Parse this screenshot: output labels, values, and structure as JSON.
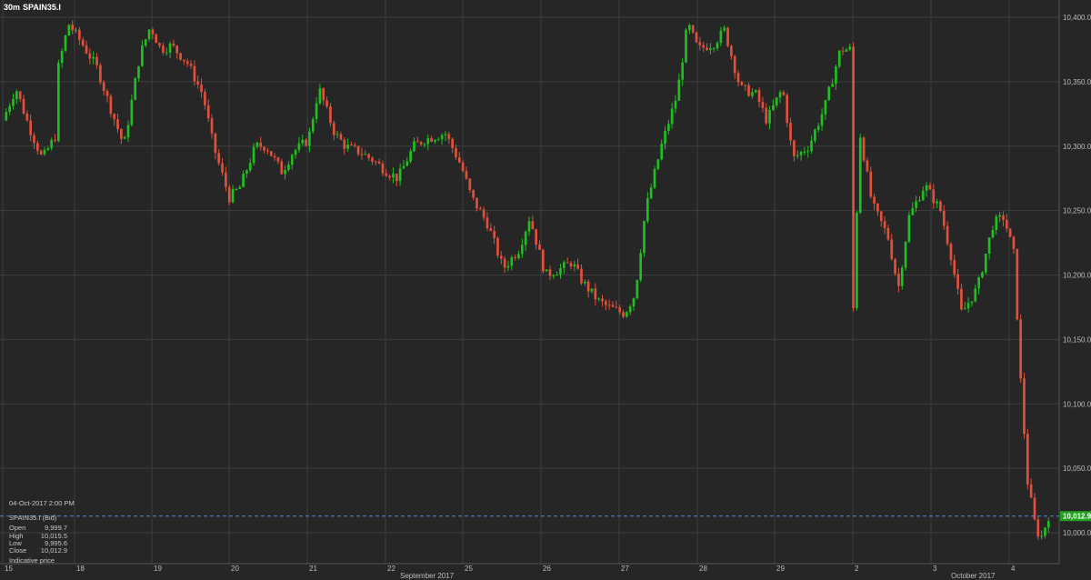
{
  "header": {
    "interval": "30m",
    "symbol": "SPAIN35.I"
  },
  "info_box": {
    "timestamp": "04-Oct-2017 2:00 PM",
    "instrument": "SPAIN35.I (Bid)",
    "rows": [
      {
        "label": "Open",
        "value": "9,999.7"
      },
      {
        "label": "High",
        "value": "10,015.5"
      },
      {
        "label": "Low",
        "value": "9,995.6"
      },
      {
        "label": "Close",
        "value": "10,012.9"
      }
    ],
    "note": "Indicative price"
  },
  "last_price": {
    "value": 10012.9,
    "label": "10,012.9",
    "color": "#1fa31f"
  },
  "colors": {
    "up": "#1fbf1f",
    "down": "#e0503c",
    "grid": "#444444",
    "background": "#262626",
    "dashed_line": "#4a8fd4"
  },
  "chart_data": {
    "type": "candlestick",
    "title": "",
    "xlabel": "",
    "ylabel": "",
    "ylim": [
      9980,
      10410
    ],
    "y_ticks": [
      "10,000.0",
      "10,050.0",
      "10,100.0",
      "10,150.0",
      "10,200.0",
      "10,250.0",
      "10,300.0",
      "10,350.0",
      "10,400.0"
    ],
    "y_tick_values": [
      10000,
      10050,
      10100,
      10150,
      10200,
      10250,
      10300,
      10350,
      10400
    ],
    "x_tick_labels": [
      "15",
      "18",
      "19",
      "20",
      "21",
      "22",
      "25",
      "26",
      "27",
      "28",
      "29",
      "2",
      "3",
      "4"
    ],
    "month_labels": [
      "September 2017",
      "October 2017"
    ],
    "grid": true,
    "close_path": [
      [
        15,
        10320
      ],
      [
        15.25,
        10345
      ],
      [
        15.5,
        10315
      ],
      [
        15.75,
        10290
      ],
      [
        16,
        10308
      ],
      [
        16.05,
        10360
      ],
      [
        16.25,
        10395
      ],
      [
        16.5,
        10380
      ],
      [
        16.8,
        10360
      ],
      [
        17,
        10335
      ],
      [
        17.3,
        10300
      ],
      [
        17.6,
        10370
      ],
      [
        17.8,
        10393
      ],
      [
        18,
        10375
      ],
      [
        18.2,
        10378
      ],
      [
        18.5,
        10365
      ],
      [
        18.8,
        10340
      ],
      [
        19,
        10300
      ],
      [
        19.3,
        10260
      ],
      [
        19.5,
        10268
      ],
      [
        19.8,
        10300
      ],
      [
        20,
        10300
      ],
      [
        20.3,
        10280
      ],
      [
        20.5,
        10295
      ],
      [
        20.8,
        10305
      ],
      [
        21,
        10345
      ],
      [
        21.3,
        10310
      ],
      [
        21.5,
        10300
      ],
      [
        21.8,
        10295
      ],
      [
        22,
        10290
      ],
      [
        22.3,
        10280
      ],
      [
        22.5,
        10275
      ],
      [
        22.8,
        10300
      ],
      [
        23,
        10305
      ],
      [
        23.4,
        10310
      ],
      [
        23.7,
        10285
      ],
      [
        23.9,
        10260
      ],
      [
        24.2,
        10240
      ],
      [
        24.5,
        10205
      ],
      [
        24.8,
        10220
      ],
      [
        25,
        10245
      ],
      [
        25.3,
        10200
      ],
      [
        25.6,
        10205
      ],
      [
        25.8,
        10210
      ],
      [
        26,
        10195
      ],
      [
        26.3,
        10180
      ],
      [
        26.5,
        10175
      ],
      [
        26.8,
        10170
      ],
      [
        27,
        10185
      ],
      [
        27.2,
        10250
      ],
      [
        27.5,
        10300
      ],
      [
        27.8,
        10340
      ],
      [
        28,
        10395
      ],
      [
        28.2,
        10375
      ],
      [
        28.5,
        10380
      ],
      [
        28.7,
        10390
      ],
      [
        29,
        10345
      ],
      [
        29.3,
        10340
      ],
      [
        29.5,
        10320
      ],
      [
        29.8,
        10345
      ],
      [
        30,
        10290
      ],
      [
        30.3,
        10300
      ],
      [
        30.6,
        10330
      ],
      [
        30.9,
        10375
      ],
      [
        31.1,
        10375
      ],
      [
        31.15,
        10150
      ],
      [
        31.25,
        10315
      ],
      [
        31.5,
        10255
      ],
      [
        31.8,
        10230
      ],
      [
        32,
        10190
      ],
      [
        32.2,
        10245
      ],
      [
        32.5,
        10270
      ],
      [
        32.8,
        10250
      ],
      [
        33,
        10215
      ],
      [
        33.2,
        10170
      ],
      [
        33.5,
        10190
      ],
      [
        33.8,
        10240
      ],
      [
        34,
        10245
      ],
      [
        34.2,
        10215
      ],
      [
        34.3,
        10130
      ],
      [
        34.45,
        10040
      ],
      [
        34.6,
        10005
      ],
      [
        34.7,
        9995
      ],
      [
        34.85,
        10012.9
      ]
    ]
  }
}
